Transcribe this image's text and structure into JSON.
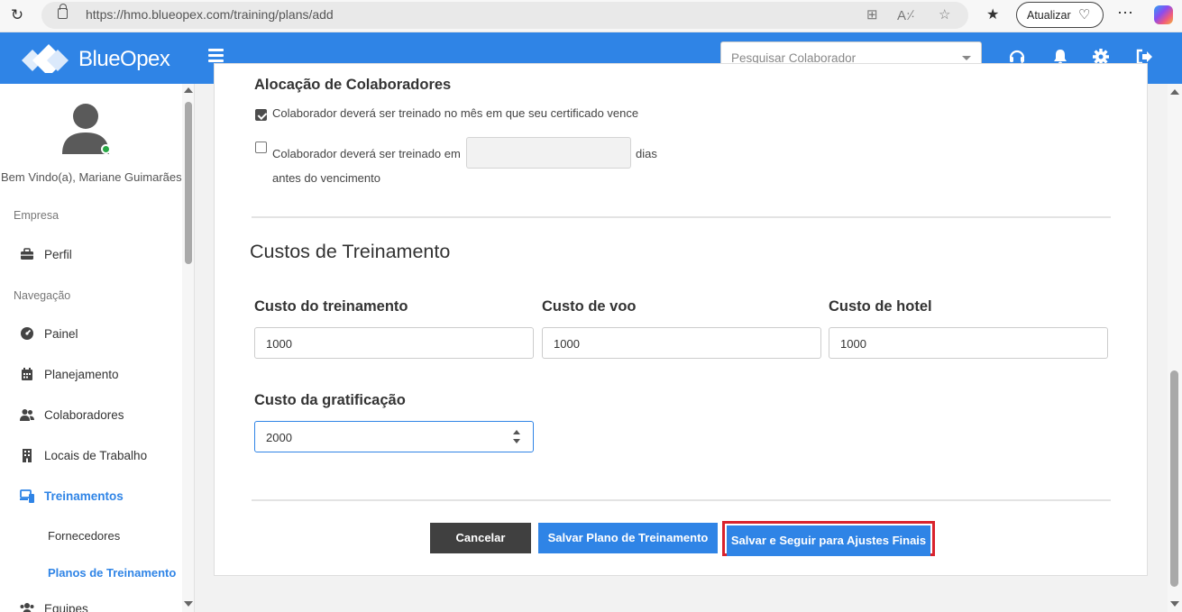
{
  "browser": {
    "url": "https://hmo.blueopex.com/training/plans/add",
    "update_label": "Atualizar"
  },
  "header": {
    "logo_text": "BlueOpex",
    "search_placeholder": "Pesquisar Colaborador"
  },
  "sidebar": {
    "welcome": "Bem Vindo(a), Mariane Guimarães",
    "section_company": "Empresa",
    "section_nav": "Navegação",
    "items": {
      "perfil": "Perfil",
      "painel": "Painel",
      "planejamento": "Planejamento",
      "colaboradores": "Colaboradores",
      "locais": "Locais de Trabalho",
      "treinamentos": "Treinamentos",
      "equipes": "Equipes"
    },
    "sub_items": {
      "fornecedores": "Fornecedores",
      "planos": "Planos de Treinamento"
    }
  },
  "allocation": {
    "title": "Alocação de Colaboradores",
    "option1": "Colaborador deverá ser treinado no mês em que seu certificado vence",
    "option2_prefix": "Colaborador deverá ser treinado em",
    "option2_suffix": "dias",
    "option2_line2": "antes do vencimento",
    "option1_checked": true,
    "option2_checked": false,
    "days_value": ""
  },
  "costs": {
    "title": "Custos de Treinamento",
    "training_label": "Custo do treinamento",
    "training_value": "1000",
    "flight_label": "Custo de voo",
    "flight_value": "1000",
    "hotel_label": "Custo de hotel",
    "hotel_value": "1000",
    "bonus_label": "Custo da gratificação",
    "bonus_value": "2000"
  },
  "actions": {
    "cancel": "Cancelar",
    "save": "Salvar Plano de Treinamento",
    "save_next": "Salvar e Seguir para Ajustes Finais"
  },
  "colors": {
    "brand": "#2f84e6",
    "highlight": "#d9232d",
    "dark_button": "#404040"
  }
}
